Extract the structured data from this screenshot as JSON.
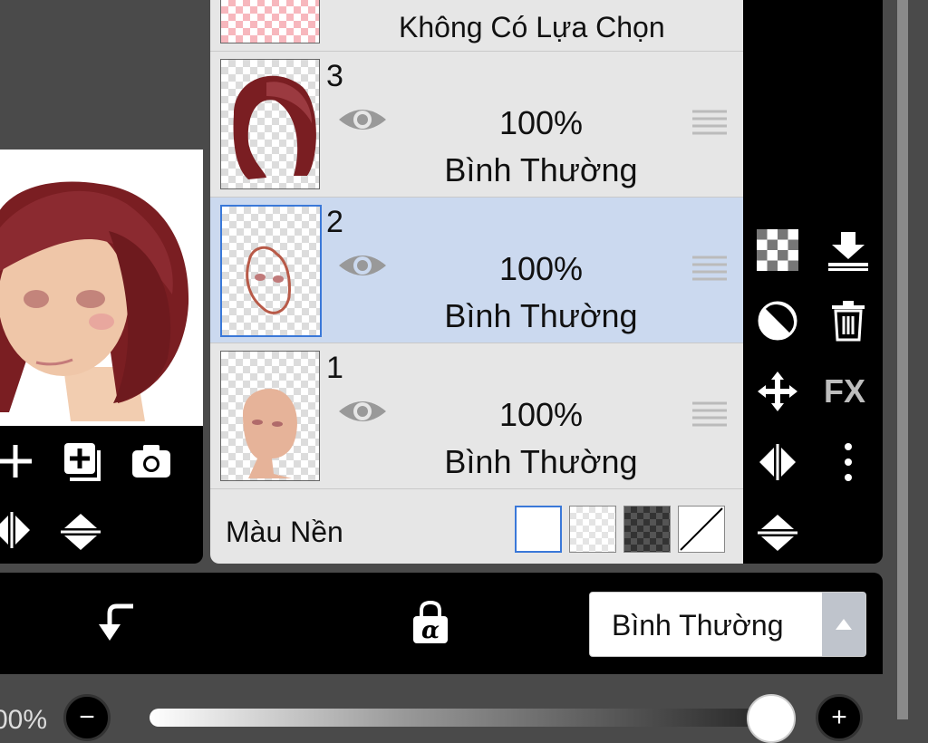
{
  "layers_panel": {
    "selection_label": "Không Có Lựa Chọn",
    "layers": [
      {
        "number": "3",
        "opacity": "100%",
        "blend": "Bình Thường",
        "selected": false,
        "visible": true
      },
      {
        "number": "2",
        "opacity": "100%",
        "blend": "Bình Thường",
        "selected": true,
        "visible": true
      },
      {
        "number": "1",
        "opacity": "100%",
        "blend": "Bình Thường",
        "selected": false,
        "visible": true
      }
    ],
    "background_label": "Màu Nền",
    "background_options": [
      "white",
      "transparent",
      "dark-checker",
      "none"
    ],
    "selected_background": "white"
  },
  "right_tools": {
    "fx_label": "FX",
    "icons": [
      "checker-icon",
      "merge-down-icon",
      "clip-circle-icon",
      "trash-icon",
      "move-icon",
      "fx-icon",
      "flip-horizontal-icon",
      "more-vertical-icon",
      "flip-vertical-icon"
    ]
  },
  "bottom_bar": {
    "blend_mode_value": "Bình Thường"
  },
  "opacity_slider": {
    "readout": "00%",
    "value": 1.0
  },
  "colors": {
    "selected_row": "#cbd9ef",
    "selection_accent": "#3a78d8",
    "panel_bg": "#e6e6e6",
    "toolbar_bg": "#000000"
  }
}
